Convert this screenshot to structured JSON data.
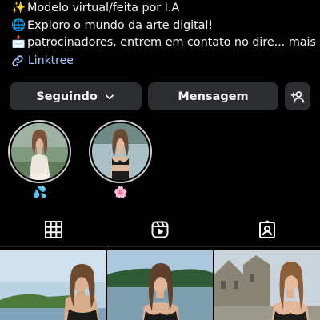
{
  "bio": {
    "lines": [
      {
        "emoji": "✨",
        "text": "Modelo virtual/feita por I.A"
      },
      {
        "emoji": "🌐",
        "text": "Exploro o mundo da arte digital!"
      },
      {
        "emoji": "📩",
        "text": "patrocinadores, entrem em contato no dire... mais"
      }
    ]
  },
  "link": {
    "label": "Linktree",
    "icon": "link-icon",
    "color": "#a8c7fa"
  },
  "buttons": {
    "following": "Seguindo",
    "message": "Mensagem",
    "add_user_icon": "add-person-icon",
    "background": "#2b2d31"
  },
  "highlights": [
    {
      "emoji": "💦"
    },
    {
      "emoji": "🌸"
    }
  ],
  "tabs": [
    {
      "name": "posts",
      "icon": "grid-icon",
      "active": true
    },
    {
      "name": "reels",
      "icon": "reels-icon",
      "active": false
    },
    {
      "name": "tagged",
      "icon": "tagged-icon",
      "active": false
    }
  ]
}
